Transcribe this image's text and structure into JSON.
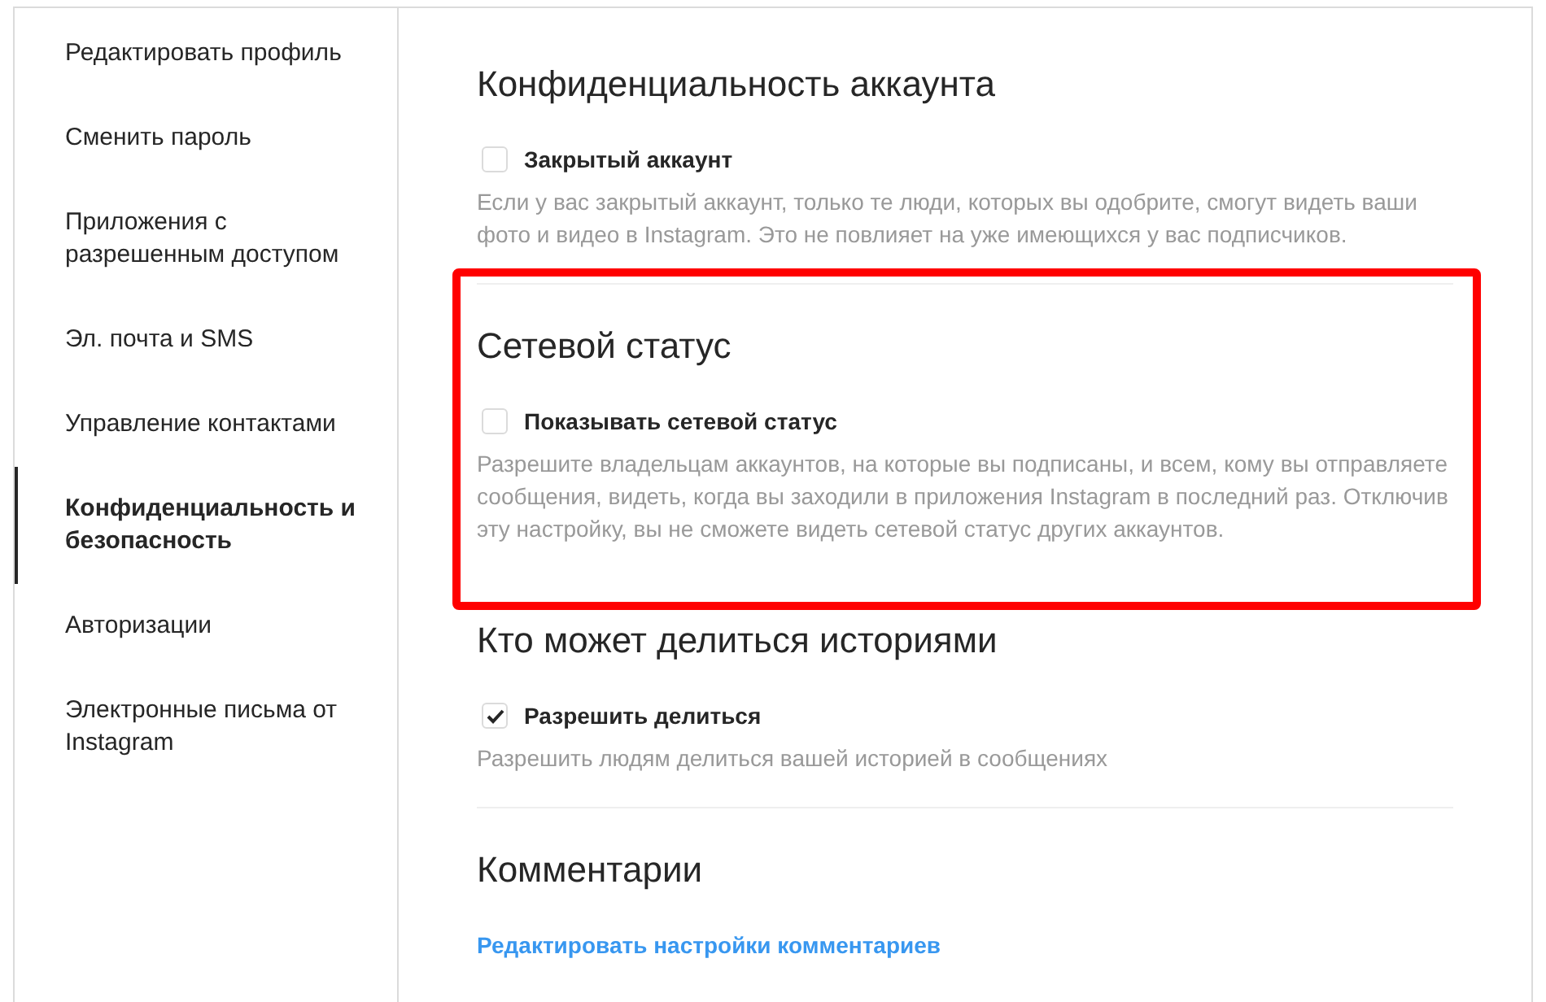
{
  "sidebar": {
    "items": [
      {
        "label": "Редактировать профиль",
        "selected": false
      },
      {
        "label": "Сменить пароль",
        "selected": false
      },
      {
        "label": "Приложения с разрешенным доступом",
        "selected": false
      },
      {
        "label": "Эл. почта и SMS",
        "selected": false
      },
      {
        "label": "Управление контактами",
        "selected": false
      },
      {
        "label": "Конфиденциальность и безопасность",
        "selected": true
      },
      {
        "label": "Авторизации",
        "selected": false
      },
      {
        "label": "Электронные письма от Instagram",
        "selected": false
      }
    ]
  },
  "sections": [
    {
      "title": "Конфиденциальность аккаунта",
      "highlighted": false,
      "divider": true,
      "kind": "checkbox",
      "option": {
        "label": "Закрытый аккаунт",
        "checked": false
      },
      "description": "Если у вас закрытый аккаунт, только те люди, которых вы одобрите, смогут видеть ваши фото и видео в Instagram. Это не повлияет на уже имеющихся у вас подписчиков."
    },
    {
      "title": "Сетевой статус",
      "highlighted": true,
      "divider": false,
      "kind": "checkbox",
      "option": {
        "label": "Показывать сетевой статус",
        "checked": false
      },
      "description": "Разрешите владельцам аккаунтов, на которые вы подписаны, и всем, кому вы отправляете сообщения, видеть, когда вы заходили в приложения Instagram в последний раз. Отключив эту настройку, вы не сможете видеть сетевой статус других аккаунтов."
    },
    {
      "title": "Кто может делиться историями",
      "highlighted": false,
      "divider": true,
      "kind": "checkbox",
      "option": {
        "label": "Разрешить делиться",
        "checked": true
      },
      "description": "Разрешить людям делиться вашей историей в сообщениях"
    },
    {
      "title": "Комментарии",
      "highlighted": false,
      "divider": false,
      "kind": "link",
      "link": "Редактировать настройки комментариев"
    }
  ]
}
